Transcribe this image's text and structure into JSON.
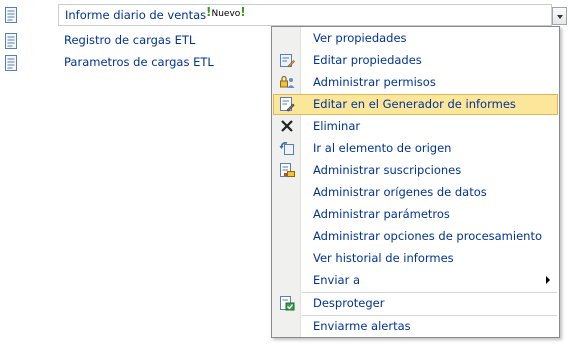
{
  "list": {
    "selected_item": {
      "label": "Informe diario de ventas",
      "badge": "Nuevo",
      "badge_mark": "!"
    },
    "items": [
      {
        "label": "Registro de cargas ETL"
      },
      {
        "label": "Parametros de cargas ETL"
      }
    ]
  },
  "menu": {
    "items": [
      {
        "label": "Ver propiedades",
        "icon": "none"
      },
      {
        "label": "Editar propiedades",
        "icon": "edit-properties-icon"
      },
      {
        "label": "Administrar permisos",
        "icon": "permissions-icon"
      },
      {
        "label": "Editar en el Generador de informes",
        "icon": "report-builder-icon",
        "highlighted": true
      },
      {
        "label": "Eliminar",
        "icon": "delete-icon"
      },
      {
        "label": "Ir al elemento de origen",
        "icon": "go-to-source-icon"
      },
      {
        "label": "Administrar suscripciones",
        "icon": "subscriptions-icon"
      },
      {
        "label": "Administrar orígenes de datos",
        "icon": "none"
      },
      {
        "label": "Administrar parámetros",
        "icon": "none"
      },
      {
        "label": "Administrar opciones de procesamiento",
        "icon": "none"
      },
      {
        "label": "Ver historial de informes",
        "icon": "none"
      },
      {
        "label": "Enviar a",
        "icon": "none",
        "submenu": true
      },
      {
        "label": "Desproteger",
        "icon": "check-in-icon"
      },
      {
        "label": "Enviarme alertas",
        "icon": "none"
      }
    ]
  },
  "colors": {
    "link_text": "#003399",
    "highlight_bg": "#fbe69a",
    "highlight_border": "#e2b656",
    "menu_gutter": "#f0f0ee"
  }
}
